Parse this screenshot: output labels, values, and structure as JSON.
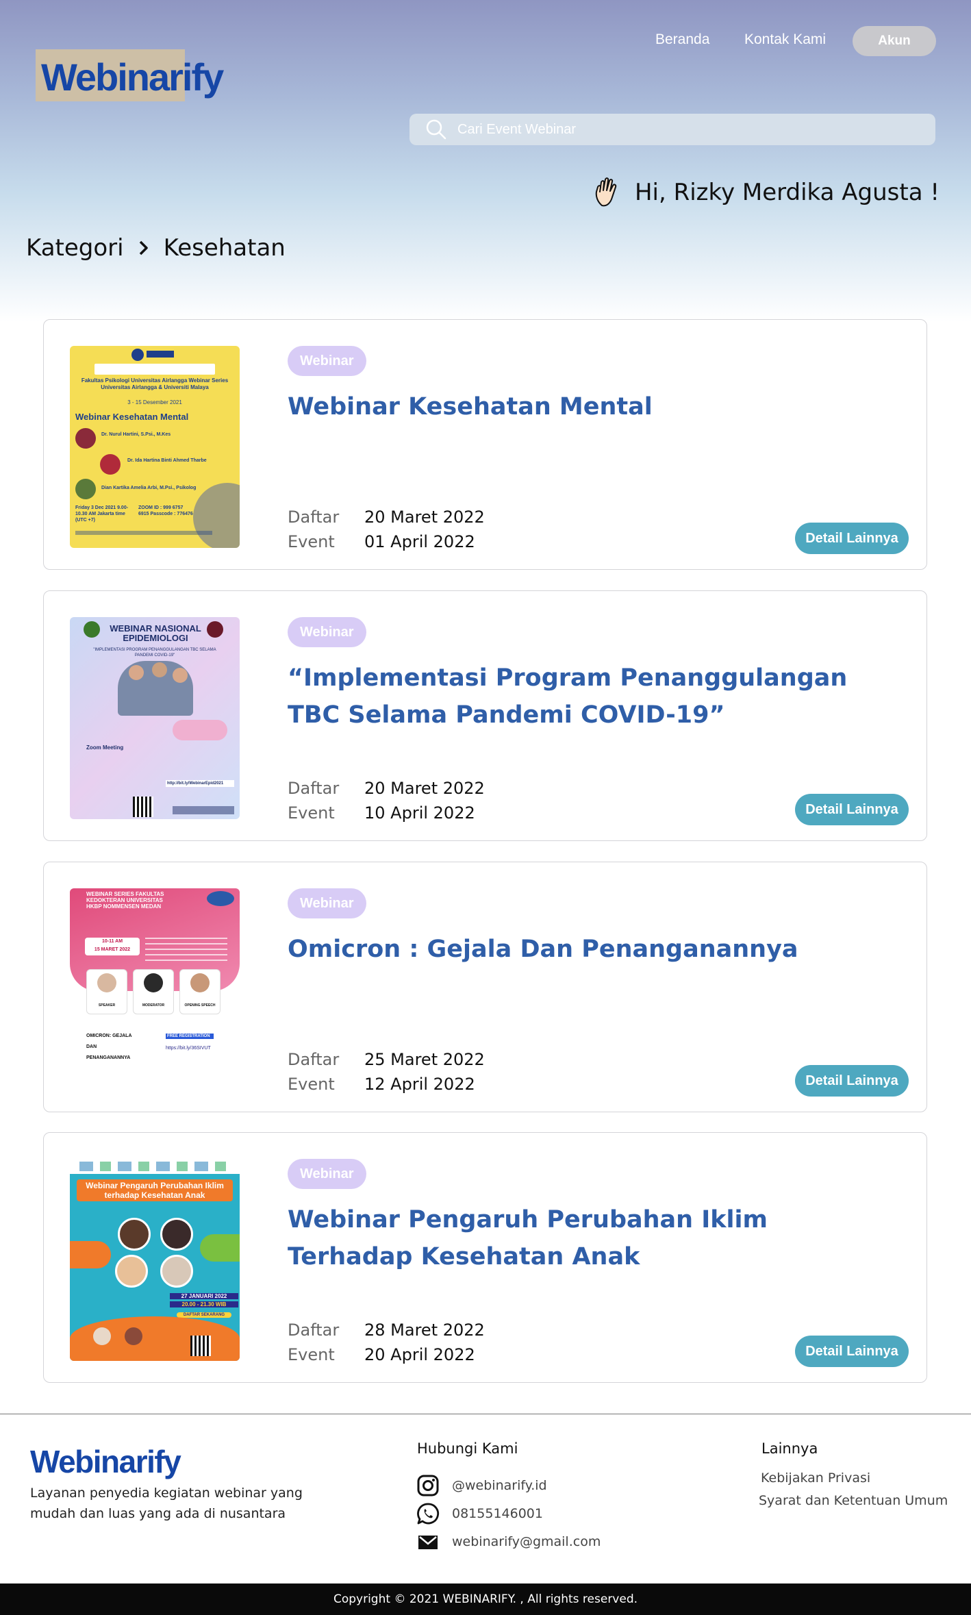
{
  "header": {
    "logo": "Webinarify",
    "nav": {
      "beranda": "Beranda",
      "kontak": "Kontak Kami",
      "akun": "Akun"
    },
    "search_placeholder": "Cari Event Webinar",
    "greeting": "Hi, Rizky Merdika Agusta !"
  },
  "breadcrumb": {
    "root": "Kategori",
    "current": "Kesehatan"
  },
  "labels": {
    "daftar": "Daftar",
    "event": "Event",
    "detail": "Detail Lainnya"
  },
  "events": [
    {
      "badge": "Webinar",
      "title": "Webinar Kesehatan Mental",
      "daftar": "20 Maret 2022",
      "event": "01 April 2022",
      "poster": {
        "header": "Fakultas Psikologi Universitas Airlangga Webinar Series Universitas Airlangga & Universiti Malaya",
        "dates": "3 - 15 Desember 2021",
        "title": "Webinar Kesehatan Mental",
        "speaker1": "Dr. Nurul Hartini, S.Psi., M.Kes",
        "speaker2": "Dr. Ida Hartina Binti Ahmed Tharbe",
        "moderator": "Dian Kartika Amelia Arbi, M.Psi., Psikolog",
        "time": "Friday 3 Dec 2021 9.00-10.30 AM Jakarta time (UTC +7)",
        "zoom": "ZOOM ID : 999 6757 6915 Passcode : 776476"
      }
    },
    {
      "badge": "Webinar",
      "title": "“Implementasi Program Penanggulangan TBC Selama Pandemi COVID-19”",
      "daftar": "20 Maret 2022",
      "event": "10 April 2022",
      "poster": {
        "title": "WEBINAR NASIONAL EPIDEMIOLOGI",
        "subtitle": "\"IMPLEMENTASI PROGRAM PENANGGULANGAN TBC SELAMA PANDEMI COVID-19\"",
        "zoom": "Zoom Meeting",
        "link": "http://bit.ly/WebinarEpid2021"
      }
    },
    {
      "badge": "Webinar",
      "title": "Omicron : Gejala Dan Penanganannya",
      "daftar": "25 Maret 2022",
      "event": "12 April 2022",
      "poster": {
        "header": "WEBINAR SERIES FAKULTAS KEDOKTERAN UNIVERSITAS HKBP NOMMENSEN MEDAN",
        "time": "10-11 AM",
        "date": "15 MARET 2022",
        "roles": [
          "SPEAKER",
          "MODERATOR",
          "OPENING SPEECH"
        ],
        "topic": "OMICRON: GEJALA DAN PENANGANANNYA",
        "reg": "FREE REGISTRATION",
        "link": "https://bit.ly/36SIVUT"
      }
    },
    {
      "badge": "Webinar",
      "title": "Webinar Pengaruh Perubahan Iklim Terhadap Kesehatan Anak",
      "daftar": "28 Maret 2022",
      "event": "20 April 2022",
      "poster": {
        "title": "Webinar Pengaruh Perubahan Iklim terhadap Kesehatan Anak",
        "date": "27 JANUARI 2022",
        "time": "20.00 - 21.30 WIB",
        "cta": "DAFTAR SEKARANG"
      }
    }
  ],
  "footer": {
    "logo": "Webinarify",
    "description": "Layanan penyedia kegiatan webinar yang mudah dan luas yang ada di nusantara",
    "contact_heading": "Hubungi Kami",
    "instagram": "@webinarify.id",
    "whatsapp": "08155146001",
    "email": "webinarify@gmail.com",
    "other_heading": "Lainnya",
    "privacy": "Kebijakan Privasi",
    "terms": "Syarat dan Ketentuan Umum",
    "copyright": "Copyright © 2021 WEBINARIFY. , All rights reserved."
  },
  "colors": {
    "brand": "#1646a6",
    "title": "#2f5ea8",
    "badge": "#d8ccf6",
    "button": "#4ea8c0"
  }
}
